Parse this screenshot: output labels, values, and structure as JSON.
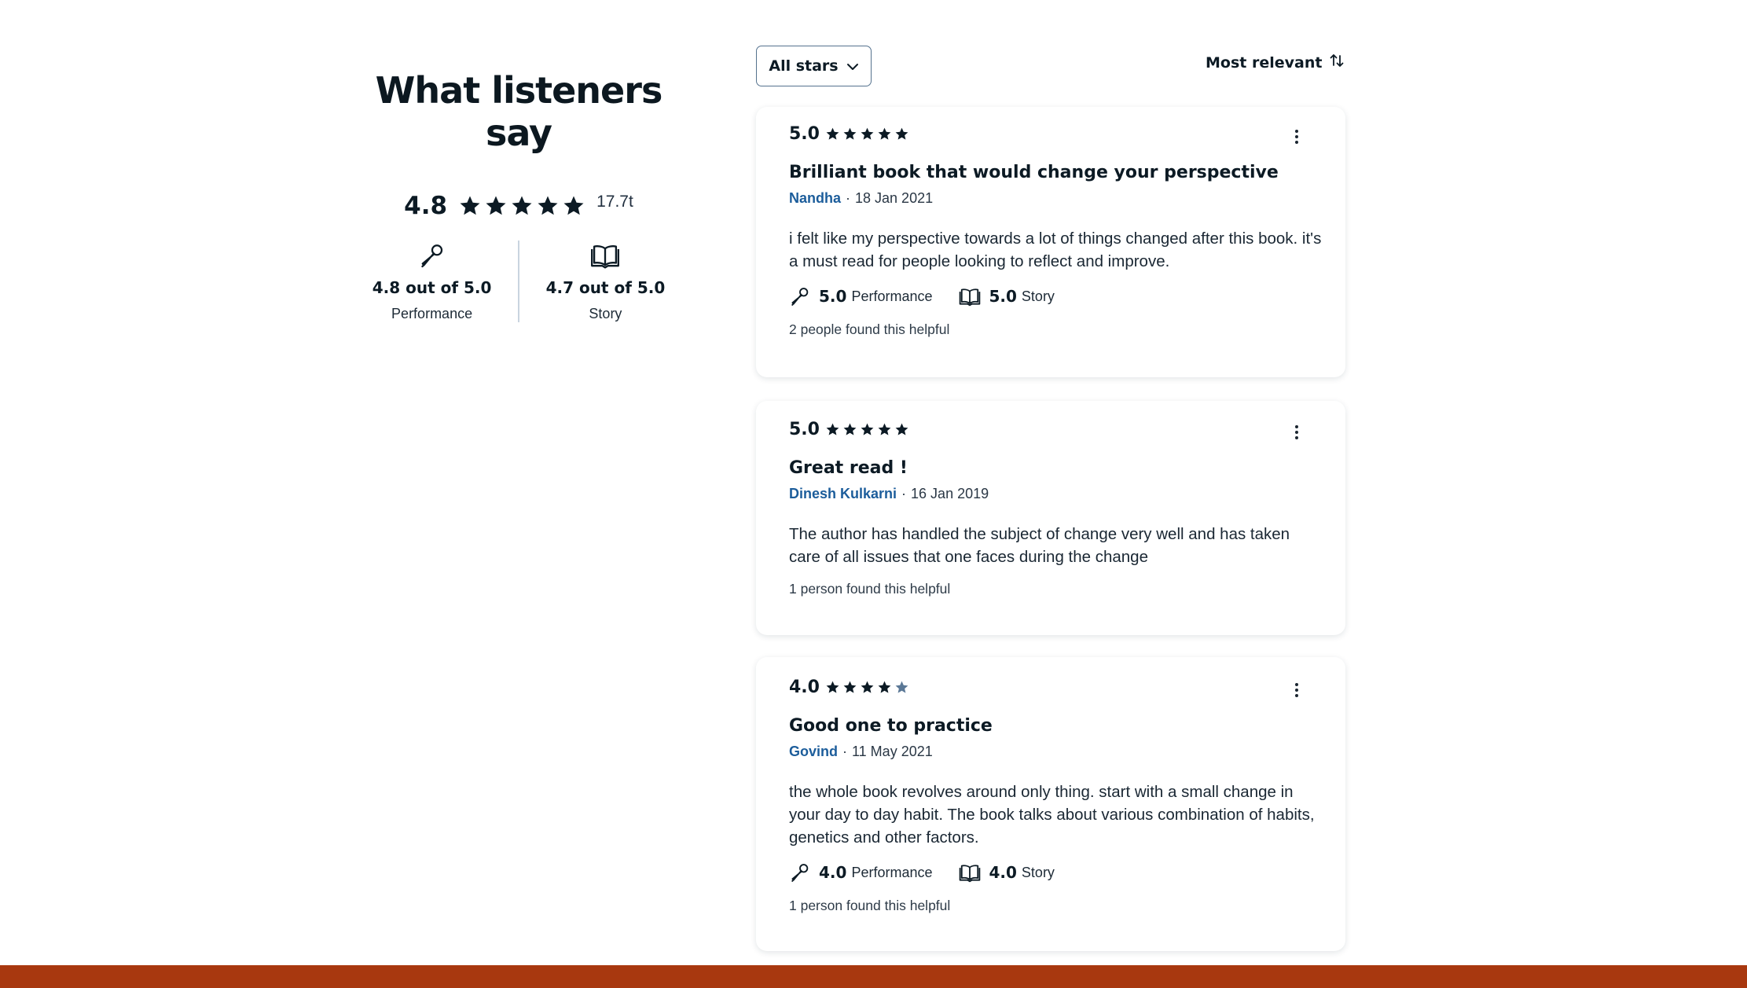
{
  "summary": {
    "title": "What listeners say",
    "overall_rating": "4.8",
    "overall_stars": 5,
    "ratings_count": "17.7t",
    "performance": {
      "value": "4.8 out of 5.0",
      "label": "Performance"
    },
    "story": {
      "value": "4.7 out of 5.0",
      "label": "Story"
    }
  },
  "toolbar": {
    "filter_label": "All stars",
    "sort_label": "Most relevant"
  },
  "reviews": [
    {
      "rating": "5.0",
      "stars": 5,
      "title": "Brilliant book that would change your perspective",
      "author": "Nandha",
      "separator": "·",
      "date": "18 Jan 2021",
      "body": "i felt like my perspective towards a lot of things changed after this book. it's a must read for people looking to reflect and improve.",
      "performance_value": "5.0",
      "performance_label": "Performance",
      "story_value": "5.0",
      "story_label": "Story",
      "helpful": "2 people found this helpful"
    },
    {
      "rating": "5.0",
      "stars": 5,
      "title": "Great read !",
      "author": "Dinesh Kulkarni",
      "separator": "·",
      "date": "16 Jan 2019",
      "body": "The author has handled the subject of change very well and has taken care of all issues that one faces during the change",
      "helpful": "1 person found this helpful"
    },
    {
      "rating": "4.0",
      "stars": 4,
      "title": "Good one to practice",
      "author": "Govind",
      "separator": "·",
      "date": "11 May 2021",
      "body": "the whole book revolves around only thing. start with a small change in your day to day habit. The book talks about various combination of habits, genetics and other factors.",
      "performance_value": "4.0",
      "performance_label": "Performance",
      "story_value": "4.0",
      "story_label": "Story",
      "helpful": "1 person found this helpful"
    }
  ],
  "colors": {
    "star_filled": "#0c1a24",
    "star_empty": "#5b7896",
    "author_link": "#1c5d9b",
    "footer_band": "#a8380f"
  },
  "icons": {
    "performance": "microphone-icon",
    "story": "book-icon",
    "filter": "chevron-down-icon",
    "sort": "sort-arrows-icon",
    "menu": "kebab-menu-icon",
    "star": "star-icon"
  }
}
